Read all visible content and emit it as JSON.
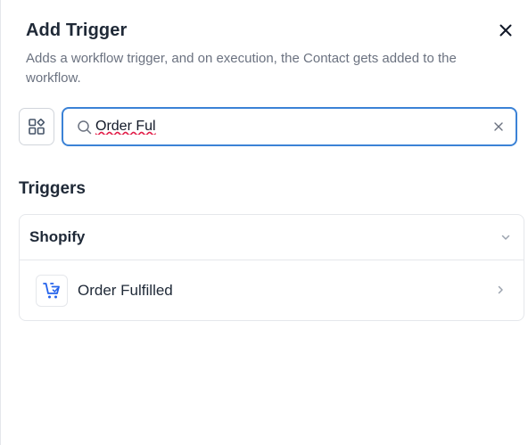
{
  "dialog": {
    "title": "Add Trigger",
    "subtitle": "Adds a workflow trigger, and on execution, the Contact gets added to the workflow.",
    "close_icon": "close-icon"
  },
  "toolbar": {
    "grid_icon": "grid-shapes-icon"
  },
  "search": {
    "value": "Order Ful",
    "search_icon": "search-icon",
    "clear_icon": "clear-icon"
  },
  "triggers": {
    "section_title": "Triggers",
    "groups": [
      {
        "label": "Shopify",
        "chevron_icon": "chevron-down-icon",
        "items": [
          {
            "label": "Order Fulfilled",
            "icon": "cart-icon",
            "chevron_icon": "chevron-right-icon"
          }
        ]
      }
    ]
  },
  "colors": {
    "accent": "#3b82d6",
    "icon_blue": "#2563eb",
    "border": "#e5e7eb",
    "muted_text": "#6b7280",
    "heading_text": "#1f2937"
  }
}
